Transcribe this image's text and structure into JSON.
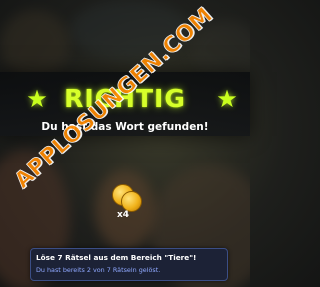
{
  "result": {
    "title": "RICHTIG",
    "subtitle": "Du hast das Wort gefunden!"
  },
  "reward": {
    "icon": "gold-coins-icon",
    "count_label": "x4"
  },
  "watermark": {
    "text": "APPLOSUNGEN.COM"
  },
  "task": {
    "title": "Löse 7 Rätsel aus dem Bereich \"Tiere\"!",
    "progress": "Du hast bereits 2 von 7 Rätseln gelöst."
  },
  "colors": {
    "accent": "#d7ff2a",
    "task_background": "#1c2236",
    "task_progress_text": "#8fa8ff",
    "watermark": "#ff8a00"
  }
}
